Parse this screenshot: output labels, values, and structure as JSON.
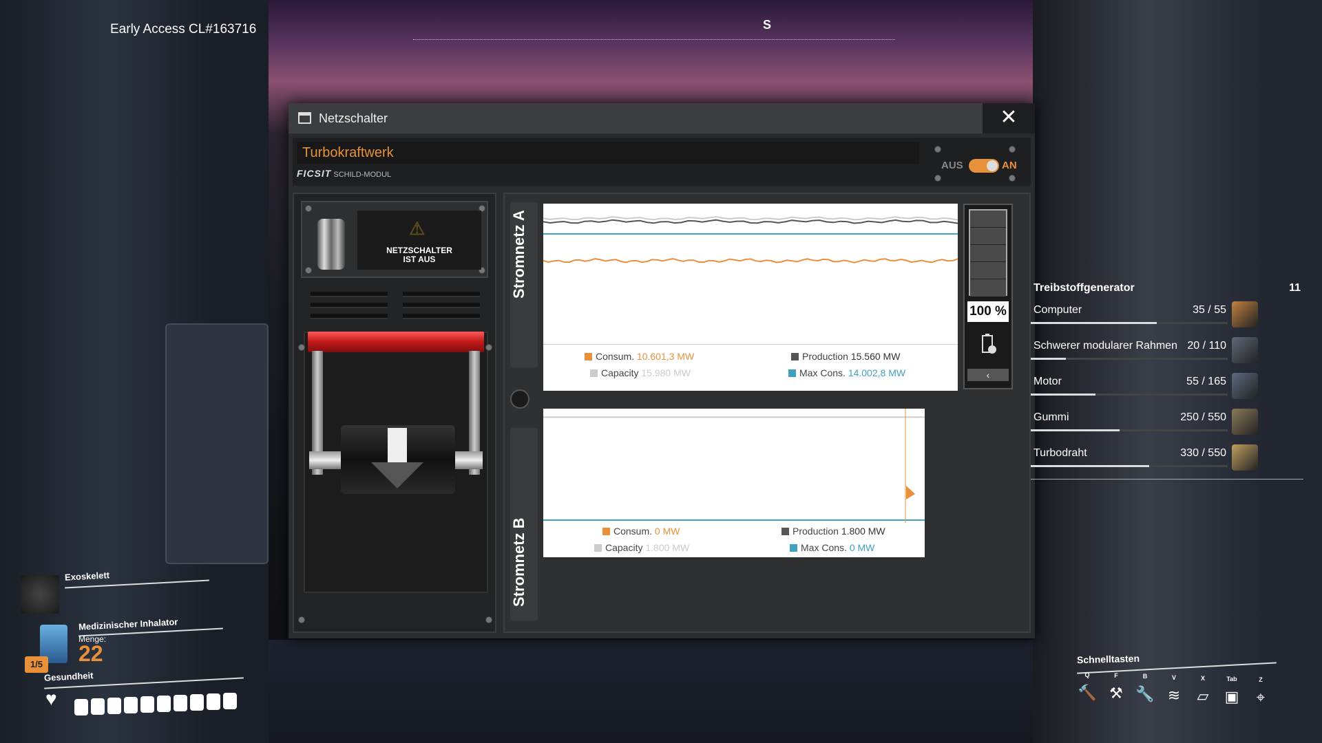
{
  "hud": {
    "build": "Early Access CL#163716",
    "compass": "S"
  },
  "window": {
    "title": "Netzschalter",
    "close_icon": "close-icon",
    "name_value": "Turbokraftwerk",
    "brand": "FICSIT",
    "module": "SCHILD-MODUL",
    "toggle_off": "AUS",
    "toggle_on": "AN",
    "toggle_state": "on",
    "status_line1": "NETZSCHALTER",
    "status_line2": "IST AUS"
  },
  "grid_a": {
    "label": "Stromnetz A",
    "consum_label": "Consum.",
    "consum_value": "10.601,3 MW",
    "production_label": "Production",
    "production_value": "15.560 MW",
    "capacity_label": "Capacity",
    "capacity_value": "15.980 MW",
    "maxcons_label": "Max Cons.",
    "maxcons_value": "14.002,8 MW",
    "battery_pct": "100 %",
    "battery_fraction": 1.0
  },
  "grid_b": {
    "label": "Stromnetz B",
    "consum_label": "Consum.",
    "consum_value": "0 MW",
    "production_label": "Production",
    "production_value": "1.800 MW",
    "capacity_label": "Capacity",
    "capacity_value": "1.800 MW",
    "maxcons_label": "Max Cons.",
    "maxcons_value": "0 MW"
  },
  "recipe": {
    "title": "Treibstoffgenerator",
    "count": "11",
    "ingredients": [
      {
        "name": "Computer",
        "amount": "35 / 55",
        "fraction": 0.64,
        "icon": "computer-icon"
      },
      {
        "name": "Schwerer modularer Rahmen",
        "amount": "20 / 110",
        "fraction": 0.18,
        "icon": "heavy-frame-icon"
      },
      {
        "name": "Motor",
        "amount": "55 / 165",
        "fraction": 0.33,
        "icon": "motor-icon"
      },
      {
        "name": "Gummi",
        "amount": "250 / 550",
        "fraction": 0.45,
        "icon": "rubber-icon"
      },
      {
        "name": "Turbodraht",
        "amount": "330 / 550",
        "fraction": 0.6,
        "icon": "wire-icon"
      }
    ]
  },
  "equipment": {
    "exo_label": "Exoskelett",
    "inhaler_label": "Medizinischer Inhalator",
    "qty_label": "Menge:",
    "qty_value": "22",
    "slot_badge": "1/5",
    "health_label": "Gesundheit",
    "health_segments": 10
  },
  "hotkeys": {
    "title": "Schnelltasten",
    "keys": [
      {
        "key": "Q",
        "icon": "build-hammer-icon"
      },
      {
        "key": "F",
        "icon": "dismantle-icon"
      },
      {
        "key": "B",
        "icon": "build-gun-icon"
      },
      {
        "key": "V",
        "icon": "signal-icon"
      },
      {
        "key": "X",
        "icon": "foundation-icon"
      },
      {
        "key": "Tab",
        "icon": "inventory-icon"
      },
      {
        "key": "Z",
        "icon": "map-marker-icon"
      }
    ]
  },
  "colors": {
    "accent": "#e8903a",
    "blue": "#40a0c0",
    "production": "#555555",
    "capacity": "#cccccc"
  }
}
